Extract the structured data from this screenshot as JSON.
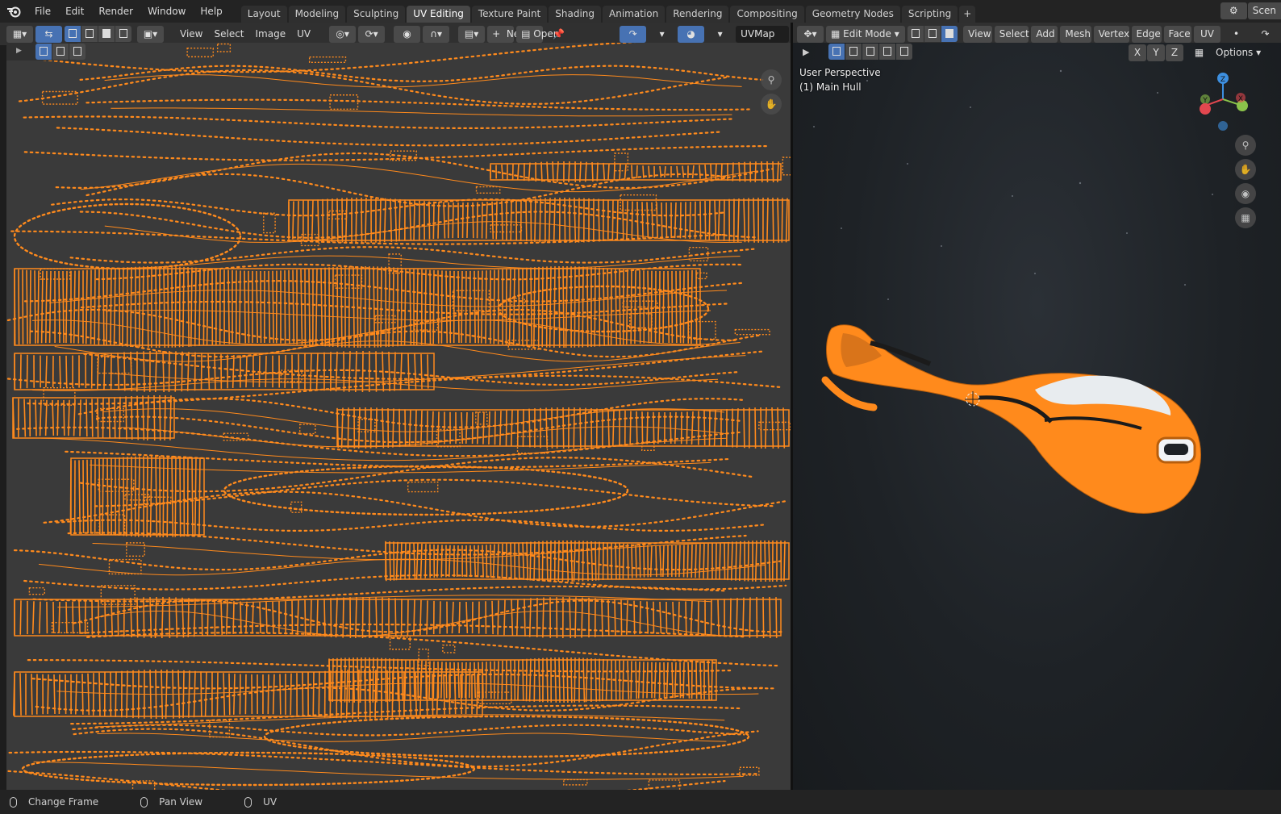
{
  "topbar": {
    "menus": [
      "File",
      "Edit",
      "Render",
      "Window",
      "Help"
    ],
    "workspaces": [
      "Layout",
      "Modeling",
      "Sculpting",
      "UV Editing",
      "Texture Paint",
      "Shading",
      "Animation",
      "Rendering",
      "Compositing",
      "Geometry Nodes",
      "Scripting"
    ],
    "active_workspace": "UV Editing",
    "add_tab_label": "+",
    "scene_label": "Scen"
  },
  "uv_editor": {
    "menus": [
      "View",
      "Select",
      "Image",
      "UV"
    ],
    "new_label": "New",
    "new_plus": "+",
    "open_label": "Open",
    "uvmap_value": "UVMap"
  },
  "viewport": {
    "mode_label": "Edit Mode",
    "menus": [
      "View",
      "Select",
      "Add",
      "Mesh",
      "Vertex",
      "Edge",
      "Face",
      "UV"
    ],
    "axis_buttons": [
      "X",
      "Y",
      "Z"
    ],
    "options_label": "Options",
    "perspective_label": "User Perspective",
    "object_label": "(1) Main Hull",
    "gizmo_axes": [
      "Z",
      "Y",
      "X"
    ]
  },
  "statusbar": {
    "items": [
      "Change Frame",
      "Pan View",
      "UV"
    ]
  },
  "colors": {
    "uv_orange": "#ff8a1c",
    "uv_background": "#3a3a3a",
    "selected_blue": "#4772b3",
    "axis_x": "#e2474f",
    "axis_y": "#8bc34a",
    "axis_z": "#3d8fe0"
  },
  "icons": [
    "blender-logo-icon",
    "editor-type-icon",
    "sync-selection-icon",
    "zoom-icon",
    "hand-icon",
    "camera-icon",
    "grid-icon",
    "pin-icon",
    "mouse-icon"
  ]
}
